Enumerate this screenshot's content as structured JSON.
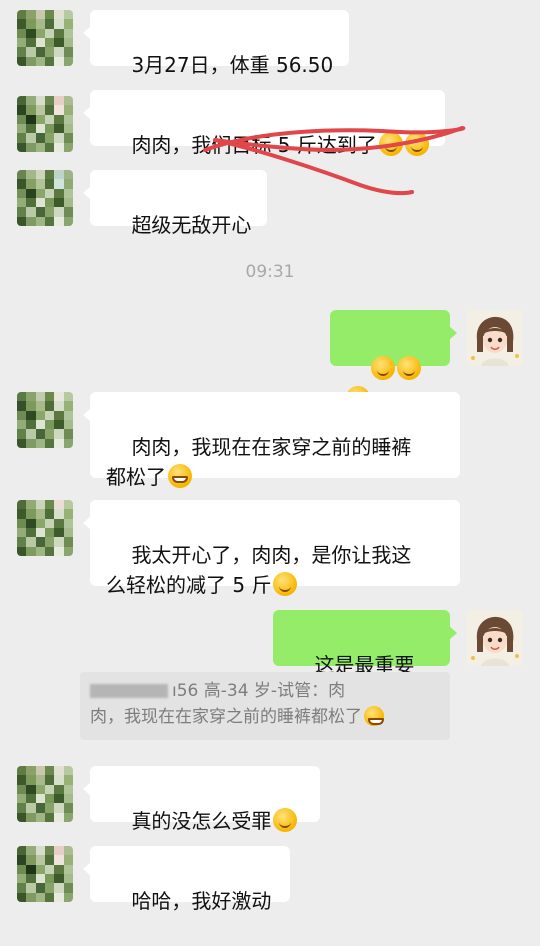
{
  "messages": [
    {
      "side": "in",
      "text": "3月27日，体重 56.50"
    },
    {
      "side": "in",
      "text": "肉肉，我们目标 5 斤达到了"
    },
    {
      "side": "in",
      "text": "超级无敌开心"
    },
    {
      "side": "out",
      "text": ""
    },
    {
      "side": "in",
      "text": "肉肉，我现在在家穿之前的睡裤\n都松了"
    },
    {
      "side": "in",
      "text": "我太开心了，肉肉，是你让我这\n么轻松的减了 5 斤"
    },
    {
      "side": "out",
      "text": "这是最重要的"
    },
    {
      "side": "in",
      "text": "真的没怎么受罪"
    },
    {
      "side": "in",
      "text": "哈哈，我好激动"
    }
  ],
  "timestamp": "09:31",
  "quote": {
    "line1": "ı56 高-34 岁-试管：肉",
    "line2": "肉，我现在在家穿之前的睡裤都松了"
  },
  "icons": {
    "emoji_thinking": "thinking-face-icon",
    "emoji_grin": "grinning-face-icon",
    "emoji_hug": "hugging-face-icon"
  },
  "colors": {
    "background": "#ededed",
    "incoming_bubble": "#ffffff",
    "outgoing_bubble": "#95ec69",
    "annotation_stroke": "#e0464a"
  }
}
